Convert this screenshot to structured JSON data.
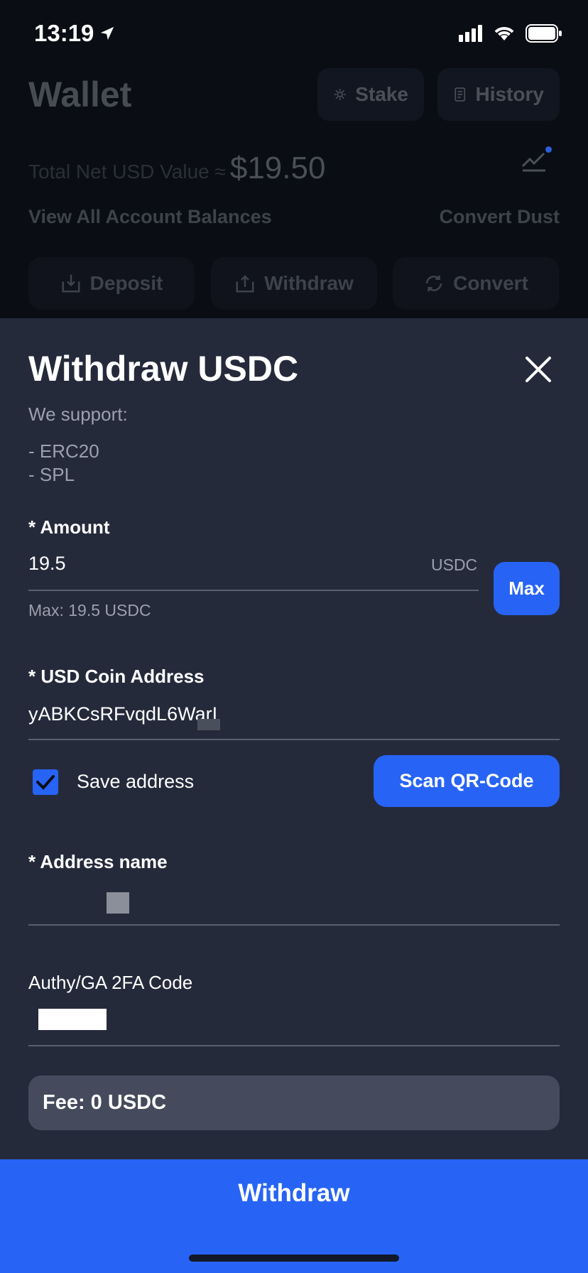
{
  "status": {
    "time": "13:19"
  },
  "wallet": {
    "title": "Wallet",
    "stake_label": "Stake",
    "history_label": "History",
    "total_label": "Total Net USD Value ≈",
    "total_value": "$19.50",
    "view_all": "View All Account Balances",
    "convert_dust": "Convert Dust",
    "actions": {
      "deposit": "Deposit",
      "withdraw": "Withdraw",
      "convert": "Convert"
    }
  },
  "sheet": {
    "title": "Withdraw USDC",
    "we_support": "We support:",
    "networks": [
      "- ERC20",
      "- SPL"
    ],
    "amount": {
      "label": "* Amount",
      "value": "19.5",
      "unit": "USDC",
      "max_button": "Max",
      "hint": "Max: 19.5 USDC"
    },
    "address": {
      "label": "* USD Coin Address",
      "value": "yABKCsRFvqdL6WarI"
    },
    "save_address": {
      "label": "Save address",
      "checked": true
    },
    "scan_button": "Scan QR-Code",
    "address_name": {
      "label": "* Address name",
      "value": ""
    },
    "twofa": {
      "label": "Authy/GA 2FA Code",
      "value": ""
    },
    "fee": "Fee: 0 USDC",
    "withdraw_button": "Withdraw"
  },
  "colors": {
    "accent": "#2764f5",
    "sheet_bg": "#252a3b",
    "fee_bg": "#454a5c"
  }
}
